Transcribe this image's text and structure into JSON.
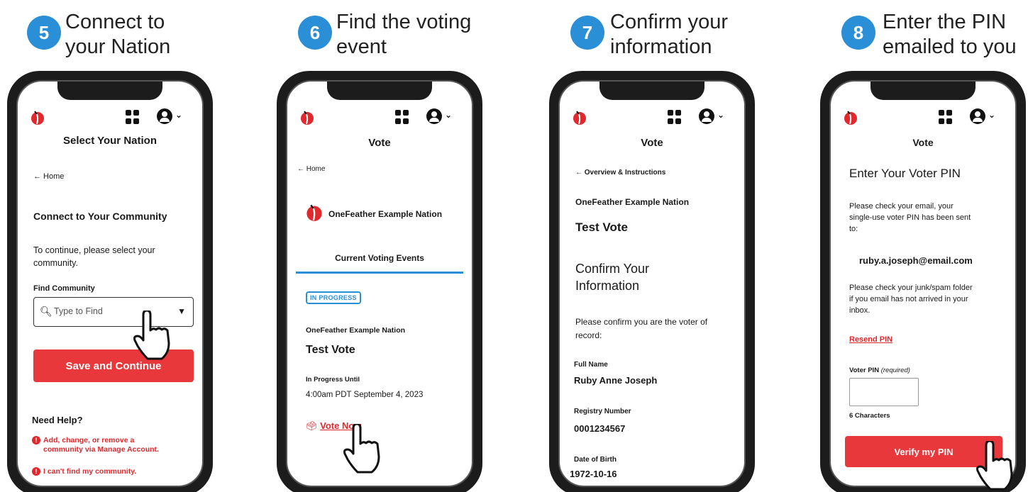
{
  "steps": [
    {
      "num": "5",
      "title_line1": "Connect to",
      "title_line2": "your Nation"
    },
    {
      "num": "6",
      "title_line1": "Find the voting",
      "title_line2": "event"
    },
    {
      "num": "7",
      "title_line1": "Confirm your",
      "title_line2": "information"
    },
    {
      "num": "8",
      "title_line1": "Enter the PIN",
      "title_line2": "emailed to you"
    }
  ],
  "screen5": {
    "page_title": "Select Your Nation",
    "back_link": "← Home",
    "heading": "Connect to Your Community",
    "instructions_line1": "To continue, please select your",
    "instructions_line2": "community.",
    "field_label": "Find Community",
    "field_placeholder": "Type to Find",
    "save_button": "Save and Continue",
    "help_heading": "Need Help?",
    "help_item1_line1": "Add, change, or remove a",
    "help_item1_line2": "community via Manage Account.",
    "help_item2": "I can't find my community."
  },
  "screen6": {
    "page_title": "Vote",
    "back_link": "← Home",
    "nation_name": "OneFeather Example Nation",
    "section_title": "Current Voting Events",
    "status_badge": "IN PROGRESS",
    "event_nation": "OneFeather Example Nation",
    "event_title": "Test Vote",
    "progress_label": "In Progress Until",
    "progress_date": "4:00am PDT September 4, 2023",
    "vote_now_link": "Vote Now"
  },
  "screen7": {
    "page_title": "Vote",
    "back_link": "← Overview & Instructions",
    "nation_name": "OneFeather Example Nation",
    "event_title": "Test Vote",
    "heading_line1": "Confirm Your",
    "heading_line2": "Information",
    "instructions_line1": "Please confirm you are the voter of",
    "instructions_line2": "record:",
    "full_name_label": "Full Name",
    "full_name_value": "Ruby Anne Joseph",
    "registry_label": "Registry Number",
    "registry_value": "0001234567",
    "dob_label": "Date of Birth",
    "dob_value": "1972-10-16"
  },
  "screen8": {
    "page_title": "Vote",
    "heading": "Enter Your Voter PIN",
    "instructions_line1": "Please check your email, your",
    "instructions_line2": "single-use voter PIN has been sent",
    "instructions_line3": "to:",
    "email": "ruby.a.joseph@email.com",
    "spam_line1": "Please check your junk/spam folder",
    "spam_line2": "if you email has not arrived in your",
    "spam_line3": "inbox.",
    "resend_link": "Resend PIN",
    "pin_label": "Voter PIN",
    "pin_required": "(required)",
    "pin_hint": "6 Characters",
    "verify_button": "Verify my PIN"
  },
  "colors": {
    "accent_blue": "#2a8fd6",
    "accent_red": "#e8383b"
  },
  "icons": [
    "onefeather-logo-icon",
    "apps-grid-icon",
    "user-account-icon",
    "chevron-down-icon",
    "pointing-hand-icon",
    "search-icon",
    "ballot-box-icon",
    "error-icon"
  ]
}
